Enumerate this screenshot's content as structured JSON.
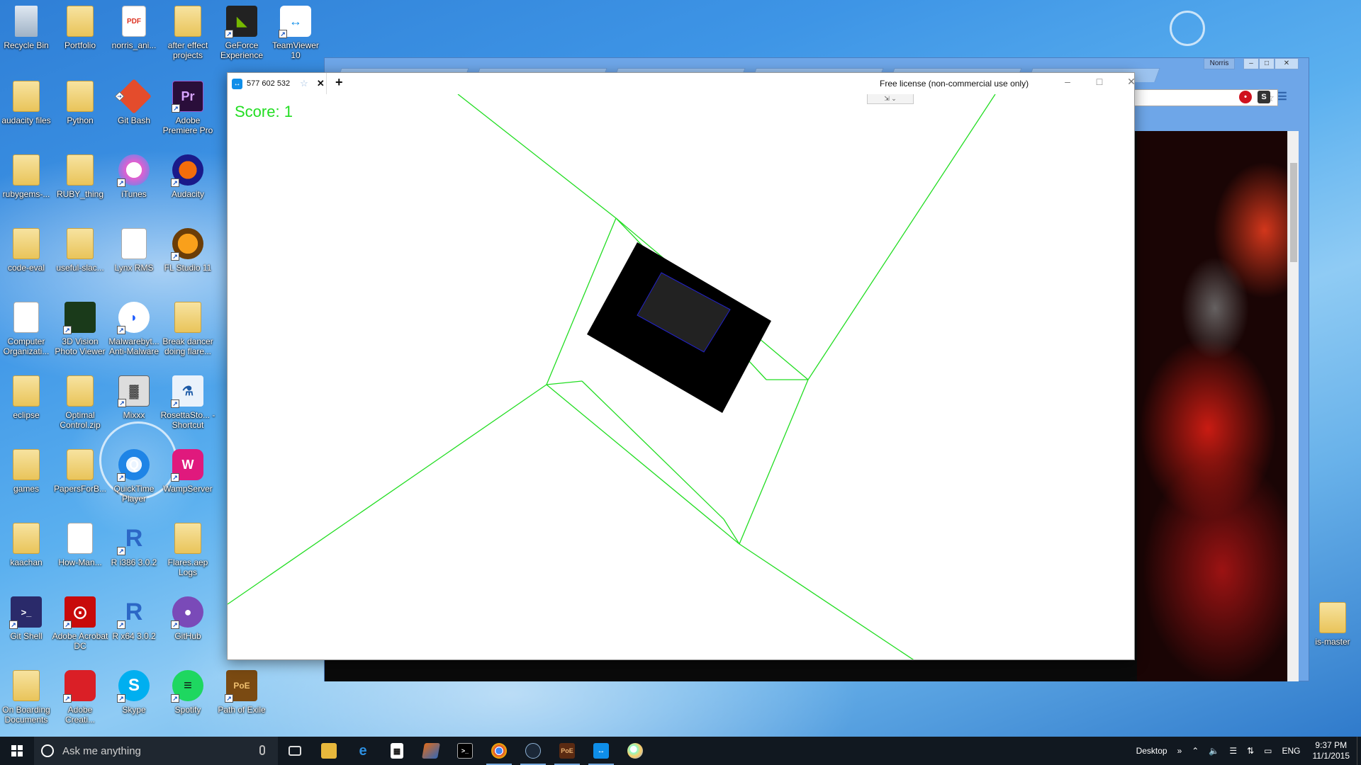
{
  "desktop": {
    "icons": [
      {
        "label": "Recycle Bin",
        "glyph": "recycle-bin-icon"
      },
      {
        "label": "Portfolio",
        "glyph": "folder-icon"
      },
      {
        "label": "norris_ani...",
        "glyph": "pdf-icon"
      },
      {
        "label": "after effect projects",
        "glyph": "folder-icon"
      },
      {
        "label": "GeForce Experience",
        "glyph": "geforce-icon"
      },
      {
        "label": "TeamViewer 10",
        "glyph": "teamviewer-icon"
      },
      {
        "label": "audacity files",
        "glyph": "folder-icon"
      },
      {
        "label": "Python",
        "glyph": "folder-icon"
      },
      {
        "label": "Git Bash",
        "glyph": "git-icon"
      },
      {
        "label": "Adobe Premiere Pro",
        "glyph": "premiere-icon"
      },
      {
        "label": "rubygems-...",
        "glyph": "folder-icon"
      },
      {
        "label": "RUBY_thing",
        "glyph": "folder-icon"
      },
      {
        "label": "iTunes",
        "glyph": "itunes-icon"
      },
      {
        "label": "Audacity",
        "glyph": "audacity-icon"
      },
      {
        "label": "code-eval",
        "glyph": "folder-icon"
      },
      {
        "label": "useful-slac...",
        "glyph": "folder-icon"
      },
      {
        "label": "Lynx RMS",
        "glyph": "document-icon"
      },
      {
        "label": "FL Studio 11",
        "glyph": "fl-studio-icon"
      },
      {
        "label": "Computer Organizati...",
        "glyph": "document-icon"
      },
      {
        "label": "3D Vision Photo Viewer",
        "glyph": "3d-vision-icon"
      },
      {
        "label": "Malwarebyt... Anti-Malware",
        "glyph": "malwarebytes-icon"
      },
      {
        "label": "Break dancer doing flare...",
        "glyph": "folder-icon"
      },
      {
        "label": "eclipse",
        "glyph": "folder-icon"
      },
      {
        "label": "Optimal Control.zip",
        "glyph": "zip-icon"
      },
      {
        "label": "Mixxx",
        "glyph": "mixxx-icon"
      },
      {
        "label": "RosettaSto... - Shortcut",
        "glyph": "rosetta-icon"
      },
      {
        "label": "games",
        "glyph": "folder-icon"
      },
      {
        "label": "PapersForB...",
        "glyph": "zip-icon"
      },
      {
        "label": "QuickTime Player",
        "glyph": "quicktime-icon"
      },
      {
        "label": "WampServer",
        "glyph": "wamp-icon"
      },
      {
        "label": "kaachan",
        "glyph": "folder-icon"
      },
      {
        "label": "How-Man...",
        "glyph": "document-icon"
      },
      {
        "label": "R i386 3.0.2",
        "glyph": "r-icon"
      },
      {
        "label": "Flares.aep Logs",
        "glyph": "folder-icon"
      },
      {
        "label": "Git Shell",
        "glyph": "terminal-icon"
      },
      {
        "label": "Adobe Acrobat DC",
        "glyph": "acrobat-icon"
      },
      {
        "label": "R x64 3.0.2",
        "glyph": "r-icon"
      },
      {
        "label": "GitHub",
        "glyph": "github-icon"
      },
      {
        "label": "On Boarding Documents",
        "glyph": "folder-icon"
      },
      {
        "label": "Adobe Creati...",
        "glyph": "creative-cloud-icon"
      },
      {
        "label": "Skype",
        "glyph": "skype-icon"
      },
      {
        "label": "Spotify",
        "glyph": "spotify-icon"
      },
      {
        "label": "Path of Exile",
        "glyph": "path-of-exile-icon"
      }
    ],
    "edge_folder_label": "is-master"
  },
  "chrome": {
    "user_label": "Norris"
  },
  "teamviewer": {
    "tab_title": "577 602 532",
    "license_text": "Free license (non-commercial use only)"
  },
  "game": {
    "score_text": "Score: 1",
    "colors": {
      "lines": "#22dd22",
      "outer_square": "#000000",
      "inner_square": "#222222",
      "inner_border": "#2222cc",
      "score": "#22dd22"
    }
  },
  "taskbar": {
    "search_placeholder": "Ask me anything",
    "pinned": [
      "task-view-icon",
      "file-explorer-icon",
      "edge-icon",
      "store-icon",
      "matlab-icon",
      "cmd-icon",
      "chrome-icon",
      "steam-icon",
      "path-of-exile-icon",
      "teamviewer-icon",
      "paint-icon"
    ],
    "desktop_label": "Desktop",
    "lang": "ENG",
    "time": "9:37 PM",
    "date": "11/1/2015"
  }
}
